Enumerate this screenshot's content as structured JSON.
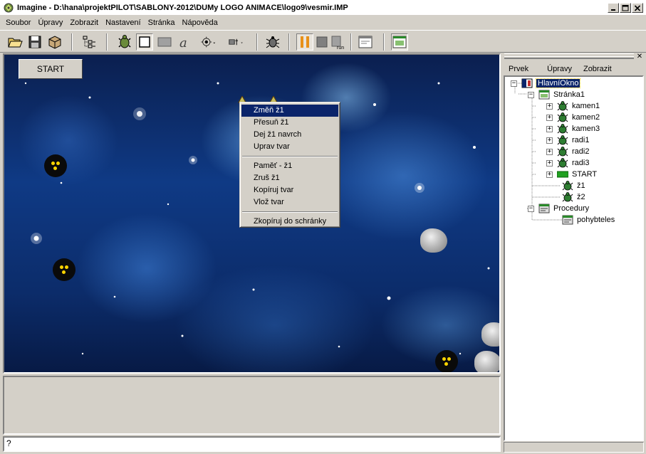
{
  "window": {
    "title": "Imagine - D:\\hana\\projektPILOT\\SABLONY-2012\\DUMy LOGO ANIMACE\\logo9\\vesmir.IMP"
  },
  "menubar": [
    "Soubor",
    "Úpravy",
    "Zobrazit",
    "Nastavení",
    "Stránka",
    "Nápověda"
  ],
  "toolbar": {
    "buttons": [
      "open-icon",
      "save-icon",
      "package-icon",
      "tree-view-icon",
      "turtle-icon",
      "frame-icon",
      "rectangle-icon",
      "text-icon",
      "slider-icon",
      "menu-icon",
      "bug-icon",
      "pause-icon",
      "stop-icon",
      "run-icon",
      "window-icon",
      "page-icon"
    ],
    "run_label": "run"
  },
  "canvas": {
    "start_button": "START"
  },
  "context_menu": {
    "items": [
      {
        "label": "Změň ž1",
        "active": true
      },
      {
        "label": "Přesuň ž1",
        "active": false
      },
      {
        "label": "Dej ž1 navrch",
        "active": false
      },
      {
        "label": "Uprav tvar",
        "active": false
      },
      {
        "label": "Paměť - ž1",
        "active": false
      },
      {
        "label": "Zruš ž1",
        "active": false
      },
      {
        "label": "Kopíruj tvar",
        "active": false
      },
      {
        "label": "Vlož tvar",
        "active": false
      },
      {
        "label": "Zkopíruj do schránky",
        "active": false
      }
    ]
  },
  "command_line": {
    "value": "?"
  },
  "right_panel": {
    "menu": [
      "Prvek",
      "Úpravy",
      "Zobrazit"
    ],
    "tree": [
      {
        "label": "HlavníOkno",
        "icon": "window-icon",
        "selected": true
      },
      {
        "label": "Stránka1",
        "icon": "page-icon"
      },
      {
        "label": "kamen1",
        "icon": "turtle-icon"
      },
      {
        "label": "kamen2",
        "icon": "turtle-icon"
      },
      {
        "label": "kamen3",
        "icon": "turtle-icon"
      },
      {
        "label": "radi1",
        "icon": "turtle-icon"
      },
      {
        "label": "radi2",
        "icon": "turtle-icon"
      },
      {
        "label": "radi3",
        "icon": "turtle-icon"
      },
      {
        "label": "START",
        "icon": "button-icon"
      },
      {
        "label": "ž1",
        "icon": "turtle-icon"
      },
      {
        "label": "ž2",
        "icon": "turtle-icon"
      },
      {
        "label": "Procedury",
        "icon": "procedures-icon"
      },
      {
        "label": "pohybteles",
        "icon": "procedure-icon"
      }
    ]
  },
  "colors": {
    "selection": "#0a246a",
    "face": "#d4d0c8",
    "radi_dot": "#ffd400"
  }
}
